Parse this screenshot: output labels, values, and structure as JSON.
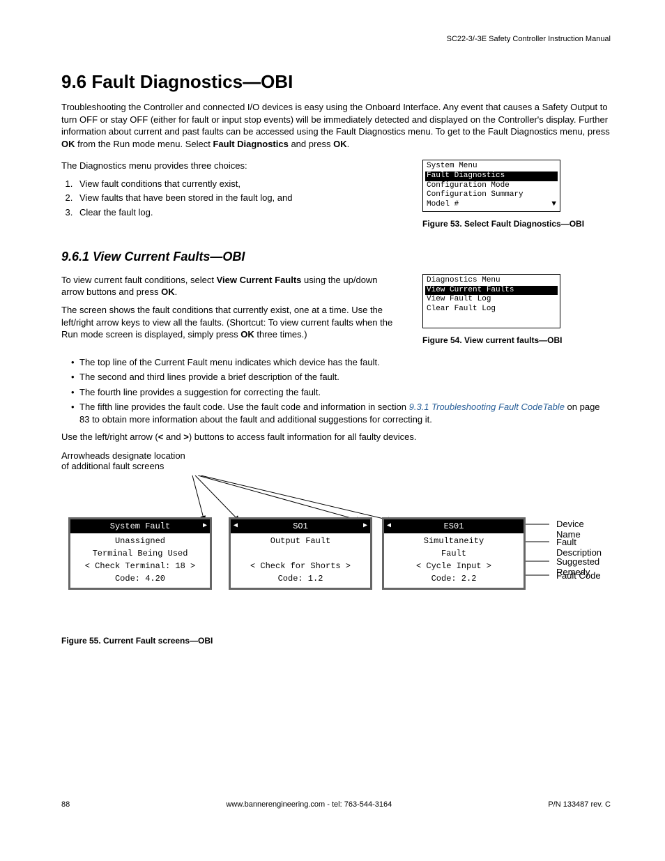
{
  "header": "SC22-3/-3E Safety Controller Instruction Manual",
  "h1": "9.6 Fault Diagnostics—OBI",
  "intro_parts": {
    "p1a": "Troubleshooting the Controller and connected I/O devices is easy using the Onboard Interface. Any event that causes a Safety Output to turn OFF or stay OFF (either for fault or input stop events) will be immediately detected and displayed on the Controller's display. Further information about current and past faults can be accessed using the Fault Diagnostics menu. To get to the Fault Diagnostics menu, press ",
    "ok1": "OK",
    "p1b": " from the Run mode menu. Select ",
    "fd": "Fault Diagnostics",
    "p1c": " and press ",
    "ok2": "OK",
    "p1d": "."
  },
  "diag_intro": "The Diagnostics menu provides three choices:",
  "diag_list": [
    "View fault conditions that currently exist,",
    "View faults that have been stored in the fault log, and",
    "Clear the fault log."
  ],
  "menu1": {
    "title": "System Menu",
    "items": [
      "Fault Diagnostics",
      "Configuration Mode",
      "Configuration Summary",
      "Model #"
    ]
  },
  "fig53": "Figure 53. Select Fault Diagnostics—OBI",
  "h2": "9.6.1 View Current Faults—OBI",
  "vcf_p1_parts": {
    "a": "To view current fault conditions, select ",
    "b": "View Current Faults",
    "c": " using the up/down arrow buttons and press ",
    "d": "OK",
    "e": "."
  },
  "vcf_p2_parts": {
    "a": "The screen shows the fault conditions that currently exist, one at a time. Use the left/right arrow keys to view all the faults. (Shortcut: To view current faults when the Run mode screen is displayed, simply press ",
    "b": "OK",
    "c": " three times.)"
  },
  "menu2": {
    "title": "Diagnostics Menu",
    "items": [
      "View Current Faults",
      "View Fault Log",
      "Clear Fault Log"
    ]
  },
  "fig54": "Figure 54. View current faults—OBI",
  "bullets": [
    "The top line of the Current Fault menu indicates which device has the fault.",
    "The second and third lines provide a brief description of the fault.",
    "The fourth line provides a suggestion for correcting the fault."
  ],
  "bullet4": {
    "a": "The fifth line provides the fault code. Use the fault code and information in section ",
    "link": "9.3.1 Troubleshooting Fault CodeTable",
    "b": " on page 83 to obtain more information about the fault and additional suggestions for correcting it."
  },
  "use_arrows": {
    "a": "Use the left/right arrow (",
    "lt": "<",
    "mid": " and ",
    "gt": ">",
    "b": ") buttons to access fault information for all faulty devices."
  },
  "arrowhead_text1": "Arrowheads designate location",
  "arrowhead_text2": "of additional fault screens",
  "fault_screens": [
    {
      "header": "System Fault",
      "left": false,
      "right": true,
      "lines": [
        "Unassigned",
        "Terminal Being Used",
        "< Check Terminal: 18 >",
        "Code: 4.20"
      ]
    },
    {
      "header": "SO1",
      "left": true,
      "right": true,
      "lines": [
        "Output Fault",
        "",
        "< Check for Shorts >",
        "Code: 1.2"
      ]
    },
    {
      "header": "ES01",
      "left": true,
      "right": false,
      "lines": [
        "Simultaneity",
        "Fault",
        "< Cycle Input >",
        "Code: 2.2"
      ]
    }
  ],
  "annotations": [
    "Device Name",
    "Fault Description",
    "Suggested Remedy",
    "Fault Code"
  ],
  "fig55": "Figure 55. Current Fault screens—OBI",
  "footer": {
    "page": "88",
    "center": "www.bannerengineering.com - tel: 763-544-3164",
    "right": "P/N 133487 rev. C"
  }
}
